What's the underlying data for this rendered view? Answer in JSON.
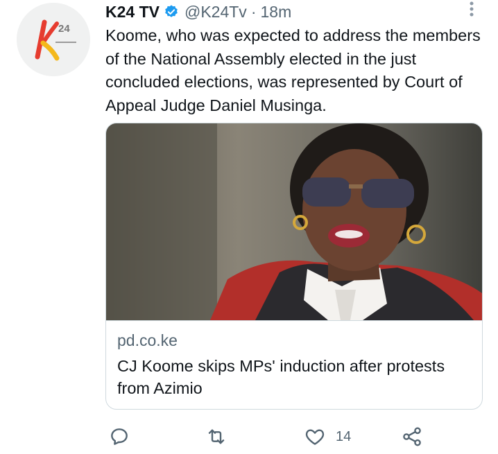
{
  "tweet": {
    "display_name": "K24 TV",
    "handle": "@K24Tv",
    "separator": "·",
    "time": "18m",
    "text": "Koome, who was expected to address the members of the National Assembly elected in the just concluded elections, was represented by Court of Appeal Judge Daniel Musinga."
  },
  "avatar": {
    "logo_text": "24"
  },
  "card": {
    "domain": "pd.co.ke",
    "title": "CJ Koome skips MPs' induction after protests from Azimio"
  },
  "actions": {
    "reply_icon": "reply-icon",
    "retweet_icon": "retweet-icon",
    "like_icon": "heart-icon",
    "like_count": "14",
    "share_icon": "share-icon"
  },
  "colors": {
    "text": "#0f1419",
    "secondary": "#536471",
    "verified": "#1d9bf0",
    "border": "#cfd9de",
    "logo_red": "#e63c2f",
    "logo_yellow": "#f4b81c"
  }
}
